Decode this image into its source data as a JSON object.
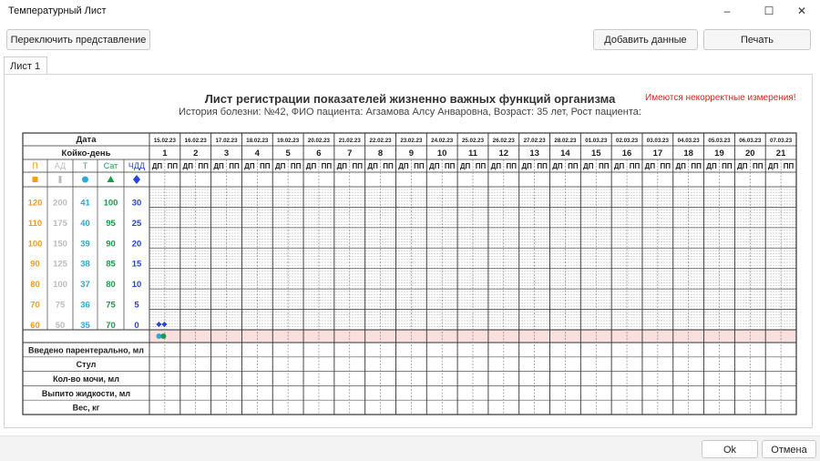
{
  "window": {
    "title": "Температурный Лист",
    "minimize": "–",
    "maximize": "☐",
    "close": "✕"
  },
  "toolbar": {
    "switch_view": "Переключить представление",
    "add_data": "Добавить данные",
    "print": "Печать"
  },
  "tabs": [
    {
      "label": "Лист 1"
    }
  ],
  "sheet": {
    "title": "Лист регистрации показателей жизненно важных функций организма",
    "subtitle": "История болезни: №42, ФИО пациента: Агзамова Алсу Анваровна, Возраст: 35 лет, Рост пациента:",
    "warning": "Имеются некорректные измерения!",
    "date_label": "Дата",
    "bed_day_label": "Койко-день",
    "shift_labels": [
      "ДП",
      "ПП"
    ],
    "dates": [
      "15.02.23",
      "16.02.23",
      "17.02.23",
      "18.02.23",
      "19.02.23",
      "20.02.23",
      "21.02.23",
      "22.02.23",
      "23.02.23",
      "24.02.23",
      "25.02.23",
      "26.02.23",
      "27.02.23",
      "28.02.23",
      "01.03.23",
      "02.03.23",
      "03.03.23",
      "04.03.23",
      "05.03.23",
      "06.03.23",
      "07.03.23"
    ],
    "bed_days": [
      "1",
      "2",
      "3",
      "4",
      "5",
      "6",
      "7",
      "8",
      "9",
      "10",
      "11",
      "12",
      "13",
      "14",
      "15",
      "16",
      "17",
      "18",
      "19",
      "20",
      "21"
    ],
    "param_headers": [
      {
        "label": "П",
        "color": "#f59b1c",
        "marker": "square"
      },
      {
        "label": "АД",
        "color": "#bcbcbc",
        "marker": "bar"
      },
      {
        "label": "Т",
        "color": "#2aa8d8",
        "marker": "circle"
      },
      {
        "label": "Сат",
        "color": "#1e9a4a",
        "marker": "triangle"
      },
      {
        "label": "ЧДД",
        "color": "#2346d8",
        "marker": "diamond"
      }
    ],
    "scale_rows": [
      [
        "120",
        "200",
        "41",
        "100",
        "30"
      ],
      [
        "110",
        "175",
        "40",
        "95",
        "25"
      ],
      [
        "100",
        "150",
        "39",
        "90",
        "20"
      ],
      [
        "90",
        "125",
        "38",
        "85",
        "15"
      ],
      [
        "80",
        "100",
        "37",
        "80",
        "10"
      ],
      [
        "70",
        "75",
        "36",
        "75",
        "5"
      ],
      [
        "60",
        "50",
        "35",
        "70",
        "0"
      ]
    ],
    "scale_colors": [
      "#f59b1c",
      "#bcbcbc",
      "#2aa8d8",
      "#1e9a4a",
      "#2346d8"
    ],
    "bottom_rows": [
      "Введено парентерально, мл",
      "Стул",
      "Кол-во мочи, мл",
      "Выпито жидкости, мл",
      "Вес, кг"
    ]
  },
  "footer": {
    "ok": "Ok",
    "cancel": "Отмена"
  }
}
